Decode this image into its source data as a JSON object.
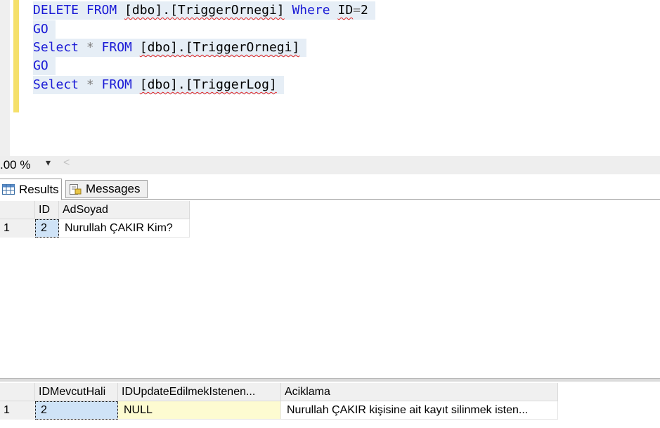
{
  "editor": {
    "lines": [
      [
        {
          "t": "DELETE FROM ",
          "c": "kw"
        },
        {
          "t": "[dbo].[TriggerOrnegi]",
          "c": "sq"
        },
        {
          "t": " Where ",
          "c": "kw"
        },
        {
          "t": "ID",
          "c": "sq"
        },
        {
          "t": "=",
          "c": "gray"
        },
        {
          "t": "2",
          "c": ""
        }
      ],
      [
        {
          "t": "GO",
          "c": "kw"
        }
      ],
      [
        {
          "t": "Select ",
          "c": "kw"
        },
        {
          "t": "* ",
          "c": "gray"
        },
        {
          "t": "FROM ",
          "c": "kw"
        },
        {
          "t": "[dbo].[TriggerOrnegi]",
          "c": "sq"
        }
      ],
      [
        {
          "t": "GO",
          "c": "kw"
        }
      ],
      [
        {
          "t": "Select ",
          "c": "kw"
        },
        {
          "t": "* ",
          "c": "gray"
        },
        {
          "t": "FROM ",
          "c": "kw"
        },
        {
          "t": "[dbo].[TriggerLog]",
          "c": "sq"
        }
      ]
    ],
    "colors": {
      "keyword": "#1a1ad6",
      "operator": "#808080",
      "squiggle": "#e02020",
      "selection": "#e6eef6",
      "change_bar": "#f5e06a"
    }
  },
  "zoom": {
    "value": ".00 %",
    "caret": "▾",
    "scroll_left": "<"
  },
  "tabs": {
    "results": "Results",
    "messages": "Messages"
  },
  "grid1": {
    "headers": [
      "ID",
      "AdSoyad"
    ],
    "rows": [
      {
        "num": "1",
        "cells": [
          "2",
          "Nurullah ÇAKIR Kim?"
        ]
      }
    ]
  },
  "grid2": {
    "headers": [
      "IDMevcutHali",
      "IDUpdateEdilmekIstenen...",
      "Aciklama"
    ],
    "rows": [
      {
        "num": "1",
        "cells": [
          "2",
          "NULL",
          "Nurullah ÇAKIR kişisine ait kayıt silinmek isten..."
        ]
      }
    ]
  },
  "icons": {
    "results_tab": "grid-icon",
    "messages_tab": "message-icon"
  }
}
